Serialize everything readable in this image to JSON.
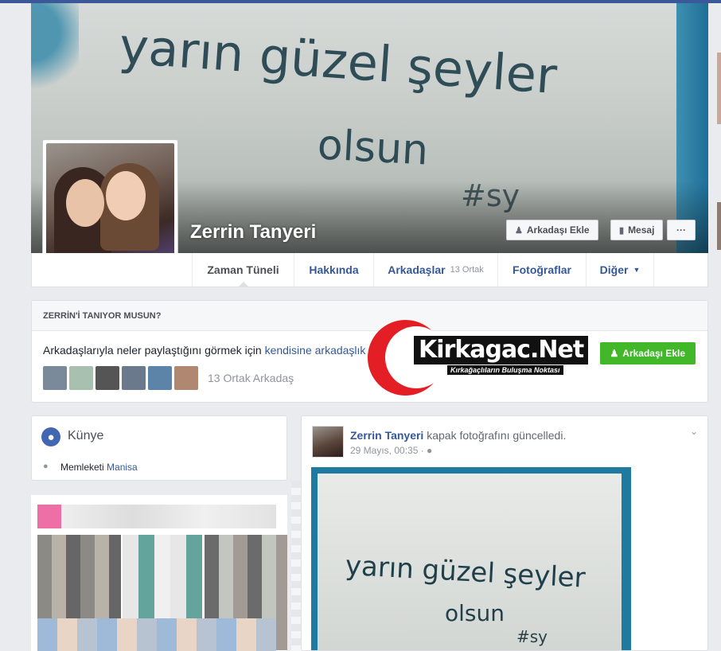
{
  "profile": {
    "name": "Zerrin Tanyeri",
    "cover_text_line1": "yarın güzel şeyler",
    "cover_text_line2": "olsun",
    "cover_text_tag": "#sy",
    "buttons": {
      "add_friend": "Arkadaşı Ekle",
      "message": "Mesaj",
      "more": "···"
    }
  },
  "tabs": [
    {
      "label": "Zaman Tüneli",
      "active": true
    },
    {
      "label": "Hakkında"
    },
    {
      "label": "Arkadaşlar",
      "sub": "13 Ortak"
    },
    {
      "label": "Fotoğraflar"
    },
    {
      "label": "Diğer",
      "dropdown": true
    }
  ],
  "know_box": {
    "header": "ZERRİN'İ TANIYOR MUSUN?",
    "line_text": "Arkadaşlarıyla neler paylaştığını görmek için",
    "line_link": "kendisine arkadaşlık isteği gö",
    "button": "Arkadaşı Ekle",
    "mutual_count": "13 Ortak Arkadaş",
    "thumb_colors": [
      "#7a8a9a",
      "#a8c0b0",
      "#555555",
      "#6a7a8c",
      "#5b84a8",
      "#b08770"
    ]
  },
  "watermark": {
    "title": "Kirkagac.Net",
    "tagline": "Kırkağaçlıların Buluşma Noktası",
    "color": "#e41e25"
  },
  "kunye": {
    "title": "Künye",
    "hometown_label": "Memleketi",
    "hometown_value": "Manisa"
  },
  "post": {
    "author": "Zerrin Tanyeri",
    "action": "kapak fotoğrafını güncelledi.",
    "time": "29 Mayıs, 00:35 · ",
    "privacy_icon": "globe-icon"
  },
  "colors": {
    "brand_blue": "#3b5998",
    "link": "#365899",
    "green": "#42b72a"
  }
}
